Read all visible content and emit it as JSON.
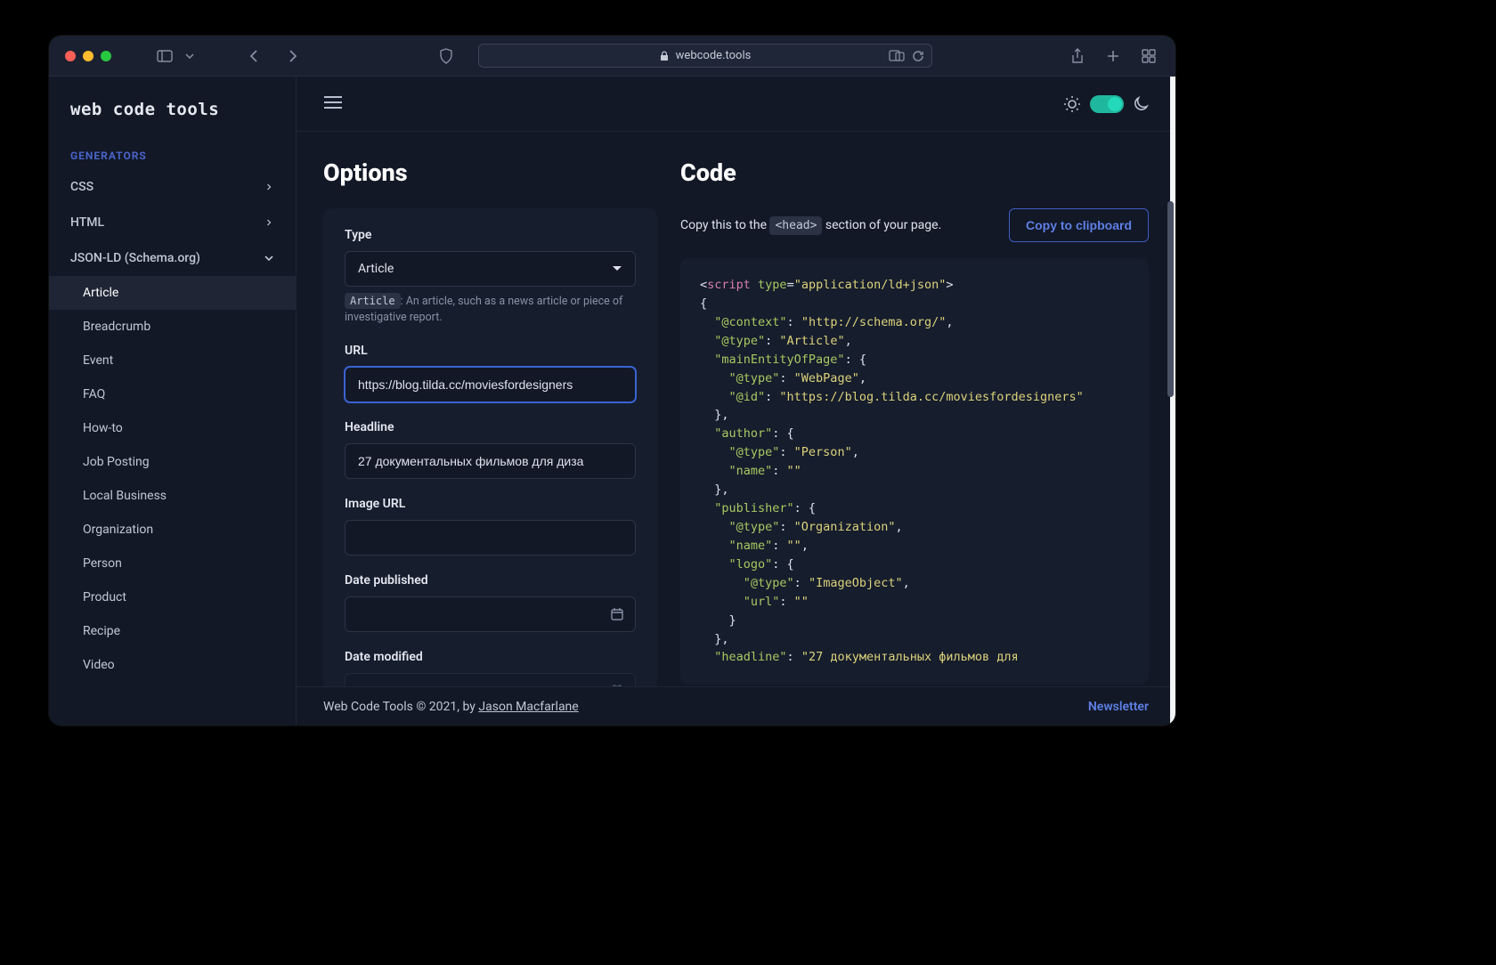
{
  "safari": {
    "url_display": "webcode.tools"
  },
  "sidebar": {
    "logo": "web code tools",
    "section_title": "GENERATORS",
    "items": [
      {
        "label": "CSS",
        "expandable": true
      },
      {
        "label": "HTML",
        "expandable": true
      },
      {
        "label": "JSON-LD (Schema.org)",
        "expandable": true,
        "expanded": true
      }
    ],
    "subitems": [
      {
        "label": "Article",
        "active": true
      },
      {
        "label": "Breadcrumb"
      },
      {
        "label": "Event"
      },
      {
        "label": "FAQ"
      },
      {
        "label": "How-to"
      },
      {
        "label": "Job Posting"
      },
      {
        "label": "Local Business"
      },
      {
        "label": "Organization"
      },
      {
        "label": "Person"
      },
      {
        "label": "Product"
      },
      {
        "label": "Recipe"
      },
      {
        "label": "Video"
      }
    ]
  },
  "options": {
    "heading": "Options",
    "type_label": "Type",
    "type_value": "Article",
    "type_help_code": "Article",
    "type_help_text": ": An article, such as a news article or piece of investigative report.",
    "url_label": "URL",
    "url_value": "https://blog.tilda.cc/moviesfordesigners",
    "headline_label": "Headline",
    "headline_value": "27 документальных фильмов для диза",
    "image_url_label": "Image URL",
    "image_url_value": "",
    "date_published_label": "Date published",
    "date_published_value": "",
    "date_modified_label": "Date modified",
    "date_modified_value": ""
  },
  "code": {
    "heading": "Code",
    "copy_prefix": "Copy this to the ",
    "copy_tag": "<head>",
    "copy_suffix": " section of your page.",
    "copy_button": "Copy to clipboard",
    "lines": {
      "l0a": "<",
      "l0b": "script",
      "l0c": " type",
      "l0d": "=",
      "l0e": "\"application/ld+json\"",
      "l0f": ">",
      "l1": "{",
      "l2a": "  \"@context\"",
      "l2b": ": ",
      "l2c": "\"http://schema.org/\"",
      "l2d": ",",
      "l3a": "  \"@type\"",
      "l3b": ": ",
      "l3c": "\"Article\"",
      "l3d": ",",
      "l4a": "  \"mainEntityOfPage\"",
      "l4b": ": {",
      "l5a": "    \"@type\"",
      "l5b": ": ",
      "l5c": "\"WebPage\"",
      "l5d": ",",
      "l6a": "    \"@id\"",
      "l6b": ": ",
      "l6c": "\"https://blog.tilda.cc/moviesfordesigners\"",
      "l7": "  },",
      "l8a": "  \"author\"",
      "l8b": ": {",
      "l9a": "    \"@type\"",
      "l9b": ": ",
      "l9c": "\"Person\"",
      "l9d": ",",
      "l10a": "    \"name\"",
      "l10b": ": ",
      "l10c": "\"\"",
      "l11": "  },",
      "l12a": "  \"publisher\"",
      "l12b": ": {",
      "l13a": "    \"@type\"",
      "l13b": ": ",
      "l13c": "\"Organization\"",
      "l13d": ",",
      "l14a": "    \"name\"",
      "l14b": ": ",
      "l14c": "\"\"",
      "l14d": ",",
      "l15a": "    \"logo\"",
      "l15b": ": {",
      "l16a": "      \"@type\"",
      "l16b": ": ",
      "l16c": "\"ImageObject\"",
      "l16d": ",",
      "l17a": "      \"url\"",
      "l17b": ": ",
      "l17c": "\"\"",
      "l18": "    }",
      "l19": "  },",
      "l20a": "  \"headline\"",
      "l20b": ": ",
      "l20c": "\"27 документальных фильмов для"
    }
  },
  "footer": {
    "text_prefix": "Web Code Tools © 2021, by ",
    "author": "Jason Macfarlane",
    "newsletter": "Newsletter"
  }
}
